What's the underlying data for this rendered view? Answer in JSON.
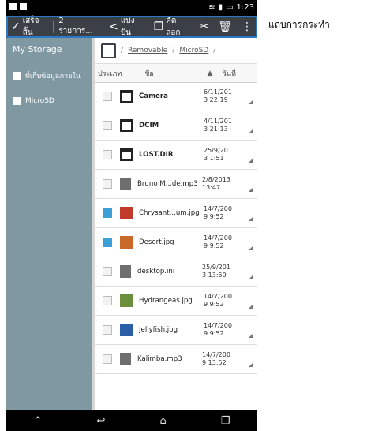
{
  "statusbar": {
    "time": "1:23"
  },
  "actionbar": {
    "done_label": "เสร็จสิ้น",
    "count_label": "2 รายการ...",
    "share_label": "แบ่งปัน",
    "copy_label": "คัดลอก",
    "cut_icon": "scissors-icon",
    "delete_icon": "trash-icon",
    "overflow_icon": "more-vert-icon"
  },
  "sidebar": {
    "title": "My Storage",
    "items": [
      {
        "label": "ที่เก็บข้อมูลภายใน"
      },
      {
        "label": "MicroSD"
      }
    ]
  },
  "path": {
    "part1": "/",
    "removable": "Removable",
    "part2": "/",
    "microsd": "MicroSD",
    "part3": "/"
  },
  "columns": {
    "type": "ประเภท",
    "name": "ชื่อ",
    "date": "วันที่"
  },
  "rows": [
    {
      "name": "Camera",
      "date_line1": "6/11/201",
      "date_line2": "3 22:19"
    },
    {
      "name": "DCIM",
      "date_line1": "4/11/201",
      "date_line2": "3 21:13"
    },
    {
      "name": "LOST.DIR",
      "date_line1": "25/9/201",
      "date_line2": "3 1:51"
    },
    {
      "name": "Bruno M...de.mp3",
      "date_line1": "2/8/2013",
      "date_line2": "13:47"
    },
    {
      "name": "Chrysant...um.jpg",
      "date_line1": "14/7/200",
      "date_line2": "9 9:52"
    },
    {
      "name": "Desert.jpg",
      "date_line1": "14/7/200",
      "date_line2": "9 9:52"
    },
    {
      "name": "desktop.ini",
      "date_line1": "25/9/201",
      "date_line2": "3 13:50"
    },
    {
      "name": "Hydrangeas.jpg",
      "date_line1": "14/7/200",
      "date_line2": "9 9:52"
    },
    {
      "name": "Jellyfish.jpg",
      "date_line1": "14/7/200",
      "date_line2": "9 9:52"
    },
    {
      "name": "Kalimba.mp3",
      "date_line1": "14/7/200",
      "date_line2": "9 13:52"
    }
  ],
  "callout": {
    "label": "แถบการกระทำ"
  },
  "colors": {
    "accent": "#2b78c5",
    "sidebar": "#7f98a2",
    "actionbar": "#3b4046"
  }
}
